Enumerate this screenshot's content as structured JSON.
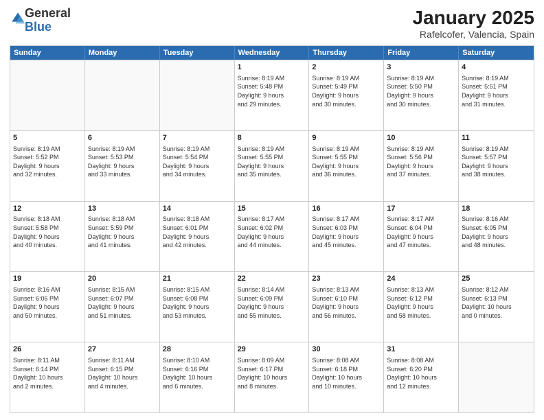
{
  "logo": {
    "general": "General",
    "blue": "Blue"
  },
  "title": "January 2025",
  "location": "Rafelcofer, Valencia, Spain",
  "days_of_week": [
    "Sunday",
    "Monday",
    "Tuesday",
    "Wednesday",
    "Thursday",
    "Friday",
    "Saturday"
  ],
  "weeks": [
    [
      {
        "day": "",
        "content": ""
      },
      {
        "day": "",
        "content": ""
      },
      {
        "day": "",
        "content": ""
      },
      {
        "day": "1",
        "content": "Sunrise: 8:19 AM\nSunset: 5:48 PM\nDaylight: 9 hours\nand 29 minutes."
      },
      {
        "day": "2",
        "content": "Sunrise: 8:19 AM\nSunset: 5:49 PM\nDaylight: 9 hours\nand 30 minutes."
      },
      {
        "day": "3",
        "content": "Sunrise: 8:19 AM\nSunset: 5:50 PM\nDaylight: 9 hours\nand 30 minutes."
      },
      {
        "day": "4",
        "content": "Sunrise: 8:19 AM\nSunset: 5:51 PM\nDaylight: 9 hours\nand 31 minutes."
      }
    ],
    [
      {
        "day": "5",
        "content": "Sunrise: 8:19 AM\nSunset: 5:52 PM\nDaylight: 9 hours\nand 32 minutes."
      },
      {
        "day": "6",
        "content": "Sunrise: 8:19 AM\nSunset: 5:53 PM\nDaylight: 9 hours\nand 33 minutes."
      },
      {
        "day": "7",
        "content": "Sunrise: 8:19 AM\nSunset: 5:54 PM\nDaylight: 9 hours\nand 34 minutes."
      },
      {
        "day": "8",
        "content": "Sunrise: 8:19 AM\nSunset: 5:55 PM\nDaylight: 9 hours\nand 35 minutes."
      },
      {
        "day": "9",
        "content": "Sunrise: 8:19 AM\nSunset: 5:55 PM\nDaylight: 9 hours\nand 36 minutes."
      },
      {
        "day": "10",
        "content": "Sunrise: 8:19 AM\nSunset: 5:56 PM\nDaylight: 9 hours\nand 37 minutes."
      },
      {
        "day": "11",
        "content": "Sunrise: 8:19 AM\nSunset: 5:57 PM\nDaylight: 9 hours\nand 38 minutes."
      }
    ],
    [
      {
        "day": "12",
        "content": "Sunrise: 8:18 AM\nSunset: 5:58 PM\nDaylight: 9 hours\nand 40 minutes."
      },
      {
        "day": "13",
        "content": "Sunrise: 8:18 AM\nSunset: 5:59 PM\nDaylight: 9 hours\nand 41 minutes."
      },
      {
        "day": "14",
        "content": "Sunrise: 8:18 AM\nSunset: 6:01 PM\nDaylight: 9 hours\nand 42 minutes."
      },
      {
        "day": "15",
        "content": "Sunrise: 8:17 AM\nSunset: 6:02 PM\nDaylight: 9 hours\nand 44 minutes."
      },
      {
        "day": "16",
        "content": "Sunrise: 8:17 AM\nSunset: 6:03 PM\nDaylight: 9 hours\nand 45 minutes."
      },
      {
        "day": "17",
        "content": "Sunrise: 8:17 AM\nSunset: 6:04 PM\nDaylight: 9 hours\nand 47 minutes."
      },
      {
        "day": "18",
        "content": "Sunrise: 8:16 AM\nSunset: 6:05 PM\nDaylight: 9 hours\nand 48 minutes."
      }
    ],
    [
      {
        "day": "19",
        "content": "Sunrise: 8:16 AM\nSunset: 6:06 PM\nDaylight: 9 hours\nand 50 minutes."
      },
      {
        "day": "20",
        "content": "Sunrise: 8:15 AM\nSunset: 6:07 PM\nDaylight: 9 hours\nand 51 minutes."
      },
      {
        "day": "21",
        "content": "Sunrise: 8:15 AM\nSunset: 6:08 PM\nDaylight: 9 hours\nand 53 minutes."
      },
      {
        "day": "22",
        "content": "Sunrise: 8:14 AM\nSunset: 6:09 PM\nDaylight: 9 hours\nand 55 minutes."
      },
      {
        "day": "23",
        "content": "Sunrise: 8:13 AM\nSunset: 6:10 PM\nDaylight: 9 hours\nand 56 minutes."
      },
      {
        "day": "24",
        "content": "Sunrise: 8:13 AM\nSunset: 6:12 PM\nDaylight: 9 hours\nand 58 minutes."
      },
      {
        "day": "25",
        "content": "Sunrise: 8:12 AM\nSunset: 6:13 PM\nDaylight: 10 hours\nand 0 minutes."
      }
    ],
    [
      {
        "day": "26",
        "content": "Sunrise: 8:11 AM\nSunset: 6:14 PM\nDaylight: 10 hours\nand 2 minutes."
      },
      {
        "day": "27",
        "content": "Sunrise: 8:11 AM\nSunset: 6:15 PM\nDaylight: 10 hours\nand 4 minutes."
      },
      {
        "day": "28",
        "content": "Sunrise: 8:10 AM\nSunset: 6:16 PM\nDaylight: 10 hours\nand 6 minutes."
      },
      {
        "day": "29",
        "content": "Sunrise: 8:09 AM\nSunset: 6:17 PM\nDaylight: 10 hours\nand 8 minutes."
      },
      {
        "day": "30",
        "content": "Sunrise: 8:08 AM\nSunset: 6:18 PM\nDaylight: 10 hours\nand 10 minutes."
      },
      {
        "day": "31",
        "content": "Sunrise: 8:08 AM\nSunset: 6:20 PM\nDaylight: 10 hours\nand 12 minutes."
      },
      {
        "day": "",
        "content": ""
      }
    ]
  ]
}
